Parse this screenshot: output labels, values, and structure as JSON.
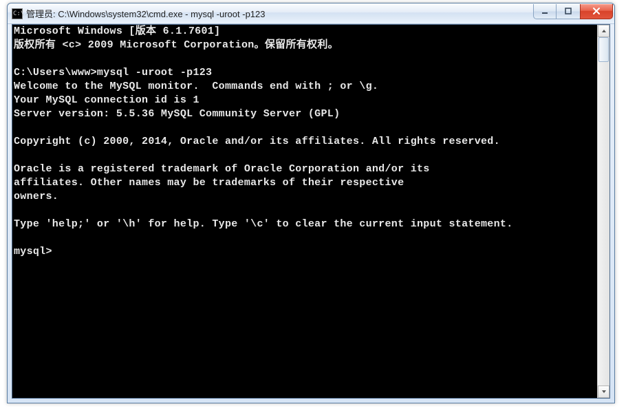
{
  "window": {
    "icon_text": "C:\\.",
    "title": "管理员: C:\\Windows\\system32\\cmd.exe - mysql  -uroot -p123"
  },
  "terminal": {
    "lines": [
      "Microsoft Windows [版本 6.1.7601]",
      "版权所有 <c> 2009 Microsoft Corporation。保留所有权利。",
      "",
      "C:\\Users\\www>mysql -uroot -p123",
      "Welcome to the MySQL monitor.  Commands end with ; or \\g.",
      "Your MySQL connection id is 1",
      "Server version: 5.5.36 MySQL Community Server (GPL)",
      "",
      "Copyright (c) 2000, 2014, Oracle and/or its affiliates. All rights reserved.",
      "",
      "Oracle is a registered trademark of Oracle Corporation and/or its",
      "affiliates. Other names may be trademarks of their respective",
      "owners.",
      "",
      "Type 'help;' or '\\h' for help. Type '\\c' to clear the current input statement.",
      "",
      "mysql>"
    ]
  },
  "controls": {
    "minimize_tip": "Minimize",
    "maximize_tip": "Maximize",
    "close_tip": "Close"
  }
}
